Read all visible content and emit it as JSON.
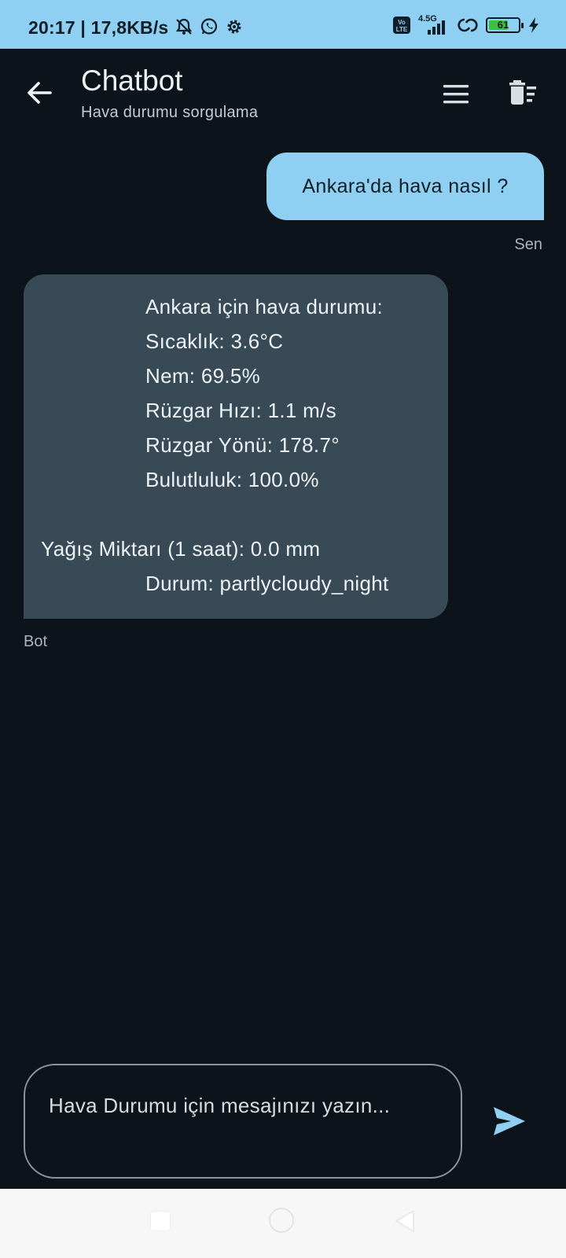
{
  "status_bar": {
    "text": "20:17 | 17,8KB/s",
    "network": "4.5G",
    "volte": "Vo LTE",
    "battery": "61"
  },
  "app_bar": {
    "title": "Chatbot",
    "subtitle": "Hava durumu sorgulama"
  },
  "messages": {
    "user": {
      "text": "Ankara'da hava nasıl ?",
      "sender": "Sen"
    },
    "bot": {
      "lines": [
        "Ankara için hava durumu:",
        "Sıcaklık: 3.6°C",
        "Nem: 69.5%",
        "Rüzgar Hızı: 1.1 m/s",
        "Rüzgar Yönü: 178.7°",
        "Bulutluluk: 100.0%",
        "Yağış Miktarı (1 saat): 0.0 mm",
        "Durum: partlycloudy_night"
      ],
      "sender": "Bot"
    }
  },
  "input": {
    "placeholder": "Hava Durumu için mesajınızı yazın..."
  },
  "colors": {
    "accent": "#8fd0f2",
    "background": "#0d131a",
    "bot_bubble": "#374a55"
  },
  "icons": {
    "back": "arrow-left-icon",
    "menu": "menu-icon",
    "delete": "delete-sweep-icon",
    "send": "send-icon"
  }
}
